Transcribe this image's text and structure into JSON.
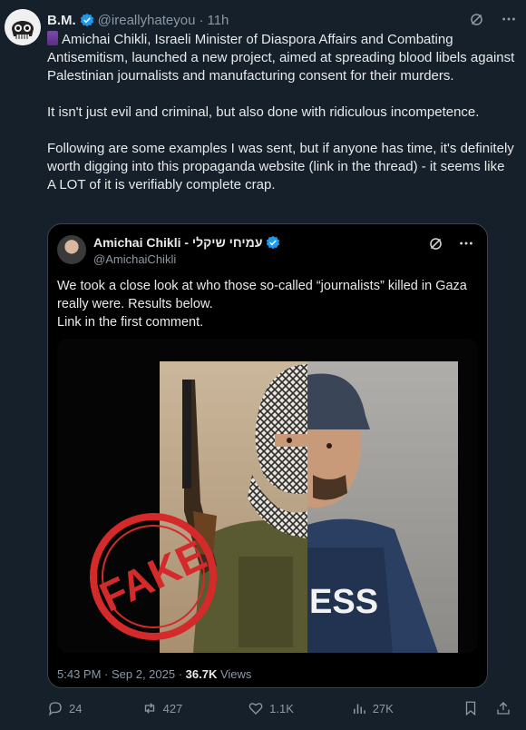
{
  "tweet": {
    "author_name": "B.M.",
    "author_handle": "@ireallyhateyou",
    "separator": "·",
    "time": "11h",
    "paragraphs": [
      "Amichai Chikli, Israeli Minister of Diaspora Affairs and Combating Antisemitism, launched a new project, aimed at spreading blood libels against Palestinian journalists and manufacturing consent for their murders.",
      "It isn't just evil and criminal, but also done with ridiculous incompetence.",
      "Following are some examples I was sent, but if anyone has time, it's definitely worth digging into this propaganda website (link in the thread) - it seems like A LOT of it is verifiably complete crap."
    ],
    "lead_emoji": "thread-spool-icon"
  },
  "quote": {
    "author_name": "עמיחי שיקלי - Amichai Chikli",
    "author_handle": "@AmichaiChikli",
    "text_lines": [
      "We took a close look at who those so-called “journalists” killed in Gaza really were. Results below.",
      "Link in the first comment."
    ],
    "image": {
      "stamp_text": "FAKE",
      "vest_text": "ESS"
    },
    "time": "5:43 PM · Sep 2, 2025",
    "sep": " · ",
    "views_count": "36.7K",
    "views_label": " Views"
  },
  "actions": {
    "replies": "24",
    "reposts": "427",
    "likes": "1.1K",
    "views": "27K"
  },
  "colors": {
    "background": "#15202b",
    "text": "#e7e9ea",
    "muted": "#8b98a5",
    "verified": "#1d9bf0",
    "border": "#38444d",
    "stamp": "#d42a2a"
  }
}
